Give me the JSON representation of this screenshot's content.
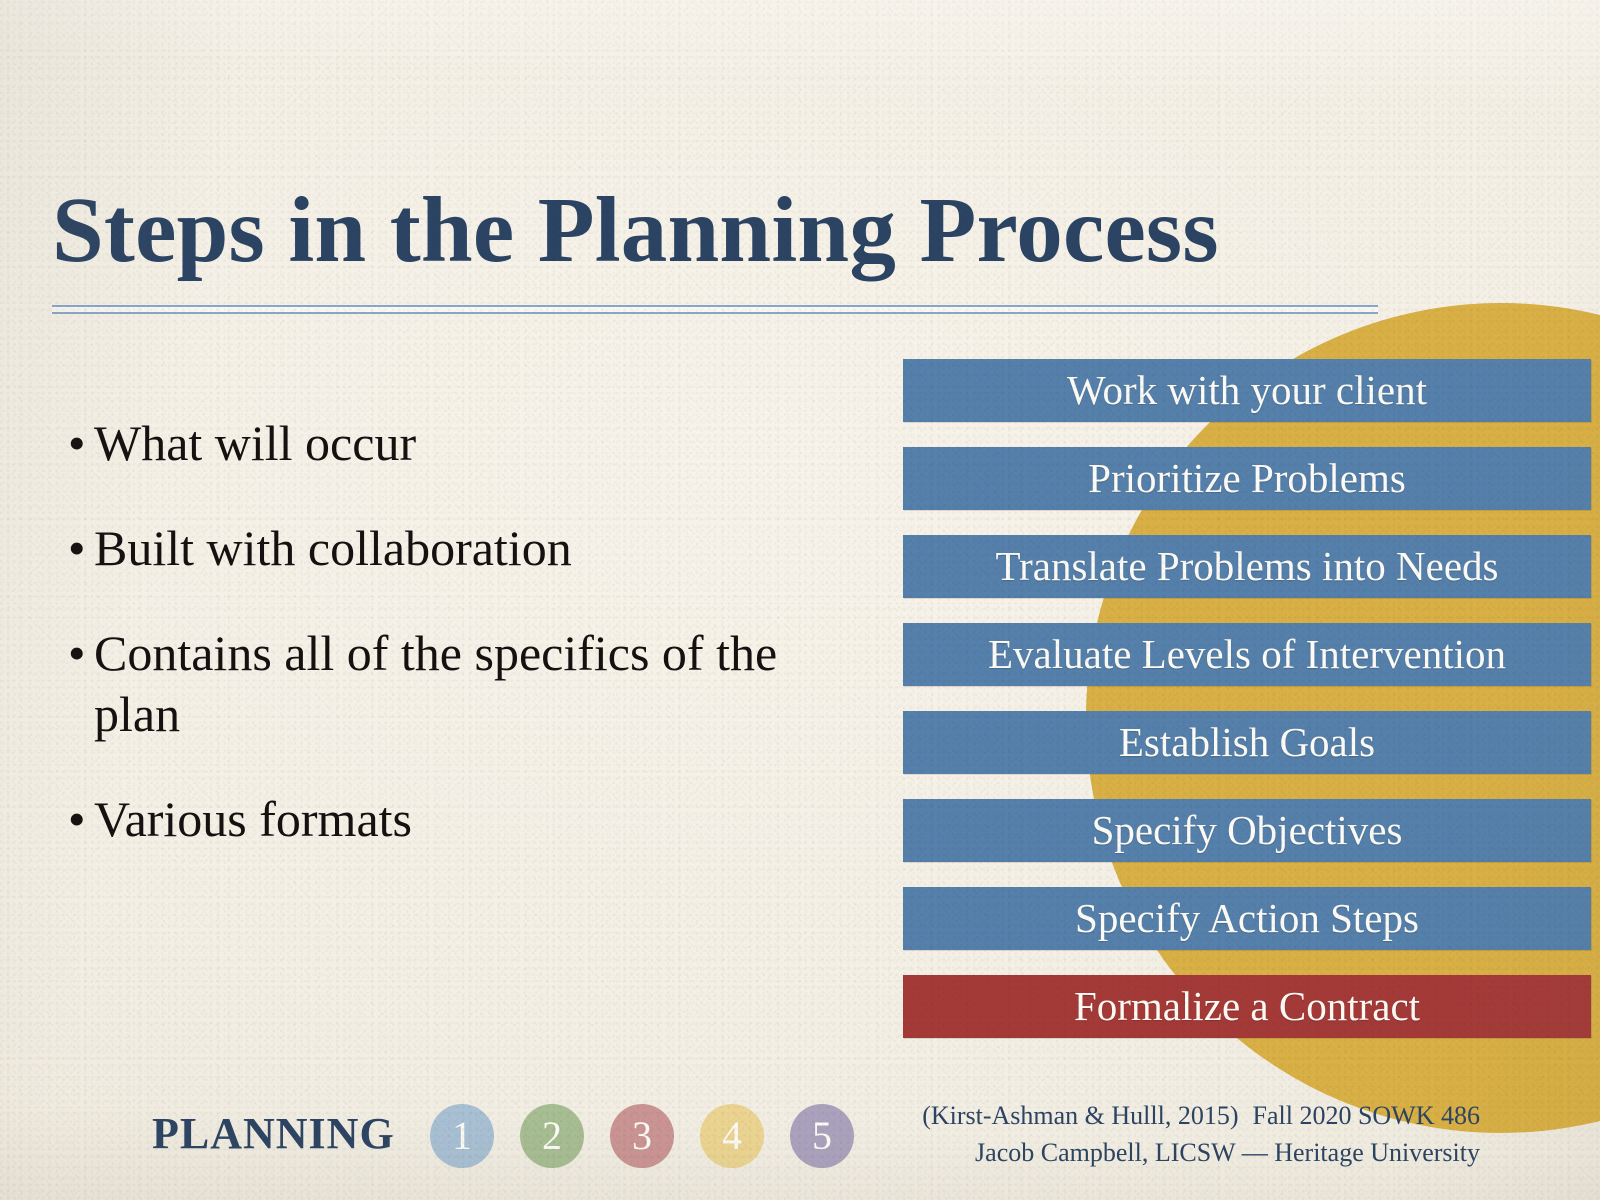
{
  "slide": {
    "title": "Steps in the Planning Process",
    "colors": {
      "ink": "#2c4463",
      "paper": "#f3efe6",
      "gold": "#d9b045",
      "blue": "#5580ab",
      "red": "#a43a38",
      "rule": "#8aa6c6"
    }
  },
  "bullets": [
    {
      "marker": "•",
      "text": "What will occur"
    },
    {
      "marker": "•",
      "text": "Built with collaboration"
    },
    {
      "marker": "•",
      "text": "Contains all of the specifics of the plan"
    },
    {
      "marker": "•",
      "text": "Various formats"
    }
  ],
  "steps": [
    {
      "label": "Work with your client",
      "color": "blue"
    },
    {
      "label": "Prioritize Problems",
      "color": "blue"
    },
    {
      "label": "Translate Problems into Needs",
      "color": "blue"
    },
    {
      "label": "Evaluate Levels of Intervention",
      "color": "blue"
    },
    {
      "label": "Establish Goals",
      "color": "blue"
    },
    {
      "label": "Specify Objectives",
      "color": "blue"
    },
    {
      "label": "Specify Action Steps",
      "color": "blue"
    },
    {
      "label": "Formalize a Contract",
      "color": "red"
    }
  ],
  "footer": {
    "section_label": "PLANNING",
    "dots": [
      {
        "number": "1",
        "color": "#a8c0d4"
      },
      {
        "number": "2",
        "color": "#a7bd92"
      },
      {
        "number": "3",
        "color": "#ca9494"
      },
      {
        "number": "4",
        "color": "#ebd491"
      },
      {
        "number": "5",
        "color": "#aaa2bd"
      }
    ],
    "citation": "(Kirst-Ashman & Hulll, 2015)",
    "course": "Fall 2020 SOWK 486",
    "presenter": "Jacob Campbell, LICSW — Heritage University"
  }
}
